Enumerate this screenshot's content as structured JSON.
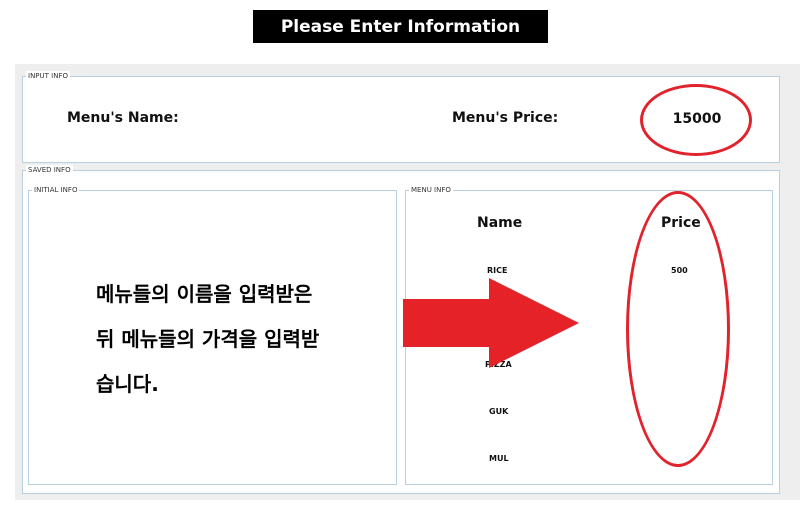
{
  "header": {
    "title": "Please Enter Information"
  },
  "input_info": {
    "legend": "INPUT INFO",
    "name_label": "Menu's Name:",
    "price_label": "Menu's Price:",
    "price_value": "15000"
  },
  "saved_info": {
    "legend": "SAVED INFO",
    "initial_info": {
      "legend": "INITIAL INFO",
      "annotation_lines": [
        "메뉴들의 이름을 입력받은",
        "뒤 메뉴들의 가격을 입력받",
        "습니다."
      ]
    },
    "menu_info": {
      "legend": "MENU INFO",
      "columns": [
        "Name",
        "Price"
      ],
      "rows": [
        {
          "name": "RICE",
          "price": "500"
        },
        {
          "name": "",
          "price": ""
        },
        {
          "name": "PIZZA",
          "price": ""
        },
        {
          "name": "GUK",
          "price": ""
        },
        {
          "name": "MUL",
          "price": ""
        }
      ]
    }
  },
  "colors": {
    "annotation_red": "#e0232c",
    "banner_bg": "#000000",
    "border": "#b8cfe0"
  }
}
